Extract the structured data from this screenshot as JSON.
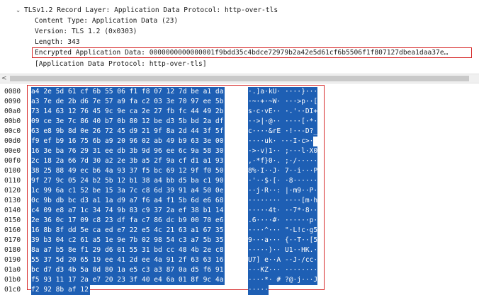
{
  "tree": {
    "record_layer": "TLSv1.2 Record Layer: Application Data Protocol: http-over-tls",
    "content_type": "Content Type: Application Data (23)",
    "version": "Version: TLS 1.2 (0x0303)",
    "length": "Length: 343",
    "encrypted_data": "Encrypted Application Data: 0000000000000001f9bdd35c4bdce72979b2a42e5d61cf6b5506f1f807127dbea1daa37e…",
    "app_protocol": "[Application Data Protocol: http-over-tls]"
  },
  "bytes": {
    "rows": [
      {
        "offset": "0080",
        "hex": "a4 2e 5d 61 cf 6b 55 06  f1 f8 07 12 7d be a1 da",
        "ascii": "·.]a·kU· ····}···"
      },
      {
        "offset": "0090",
        "hex": "a3 7e de 2b d6 7e 57 a9  fa c2 03 3e 70 97 ee 5b",
        "ascii": "·~·+·~W· ···>p··["
      },
      {
        "offset": "00a0",
        "hex": "73 14 63 12 76 45 9c 9e  ca 2e 27 fb fc 44 49 2b",
        "ascii": "s·c·vE·· ·.'··DI+"
      },
      {
        "offset": "00b0",
        "hex": "09 ce 3e 7c 86 40 b7 0b  80 12 be d3 5b bd 2a df",
        "ascii": "··>|·@·· ····[·*·"
      },
      {
        "offset": "00c0",
        "hex": "63 e8 9b 8d 0e 26 72 45  d9 21 9f 8a 2d 44 3f 5f",
        "ascii": "c····&rE ·!··-D?_"
      },
      {
        "offset": "00d0",
        "hex": "f9 ef b9 16 75 6b a9 20  96 02 ab 49 b9 63 3e 00",
        "ascii": "····uk·  ···I·c>·"
      },
      {
        "offset": "00e0",
        "hex": "16 3e ba 76 29 31 ee db  3b 9d 96 ee 6c 9a 58 30",
        "ascii": "·>·v)1·· ;···l·X0"
      },
      {
        "offset": "00f0",
        "hex": "2c 18 2a 66 7d 30 a2 2e  3b a5 2f 9a cf d1 a1 93",
        "ascii": ",·*f}0·. ;·/·····"
      },
      {
        "offset": "0100",
        "hex": "38 25 88 49 ec b6 4a 93  37 f5 bc 69 12 9f f0 50",
        "ascii": "8%·I··J· 7··i···P"
      },
      {
        "offset": "0110",
        "hex": "9f 27 9c 05 24 b2 5b 12  b1 38 a4 bb d5 ba c1 90",
        "ascii": "·'··$·[· ·8······"
      },
      {
        "offset": "0120",
        "hex": "1c 99 6a c1 52 be 15 3a  7c c8 6d 39 91 a4 50 0e",
        "ascii": "··j·R··: |·m9··P·"
      },
      {
        "offset": "0130",
        "hex": "0c 9b db bc d3 a1 1a d9  a7 f6 a4 f1 5b 6d e6 68",
        "ascii": "········ ····[m·h"
      },
      {
        "offset": "0140",
        "hex": "c4 09 e8 a7 1c 34 74 9b  83 c9 37 2a ef 38 b1 14",
        "ascii": "·····4t· ··7*·8··"
      },
      {
        "offset": "0150",
        "hex": "2e 36 0c 17 09 c8 23 df  fa c7 86 dc b9 00 70 e6",
        "ascii": ".6····#· ······p·"
      },
      {
        "offset": "0160",
        "hex": "16 8b 8f dd 5e ca ed e7  22 e5 4c 21 63 a1 67 35",
        "ascii": "····^··· \"·L!c·g5"
      },
      {
        "offset": "0170",
        "hex": "39 b3 04 c2 61 a5 1e 9e  7b 02 98 54 c3 a7 5b 35",
        "ascii": "9···a··· {··T··[5"
      },
      {
        "offset": "0180",
        "hex": "8a a7 b5 8e f1 29 d6 01  55 31 bd cc 48 4b 2e c8",
        "ascii": "·····)·· U1··HK.·"
      },
      {
        "offset": "0190",
        "hex": "55 37 5d 20 65 19 ee 41  2d ee 4a 91 2f 63 63 16",
        "ascii": "U7] e··A -·J·/cc·"
      },
      {
        "offset": "01a0",
        "hex": "bc d7 d3 4b 5a 8d 80 1a  e5 c3 a3 87 0a d5 f6 91",
        "ascii": "···KZ··· ········"
      },
      {
        "offset": "01b0",
        "hex": "f5 93 11 17 2a e7 20 23  3f 40 e4 6a 01 8f 9c 4a",
        "ascii": "····*· # ?@·j···J"
      },
      {
        "offset": "01c0",
        "hex": "f2 92 8b af 12",
        "ascii": "·····"
      }
    ]
  }
}
